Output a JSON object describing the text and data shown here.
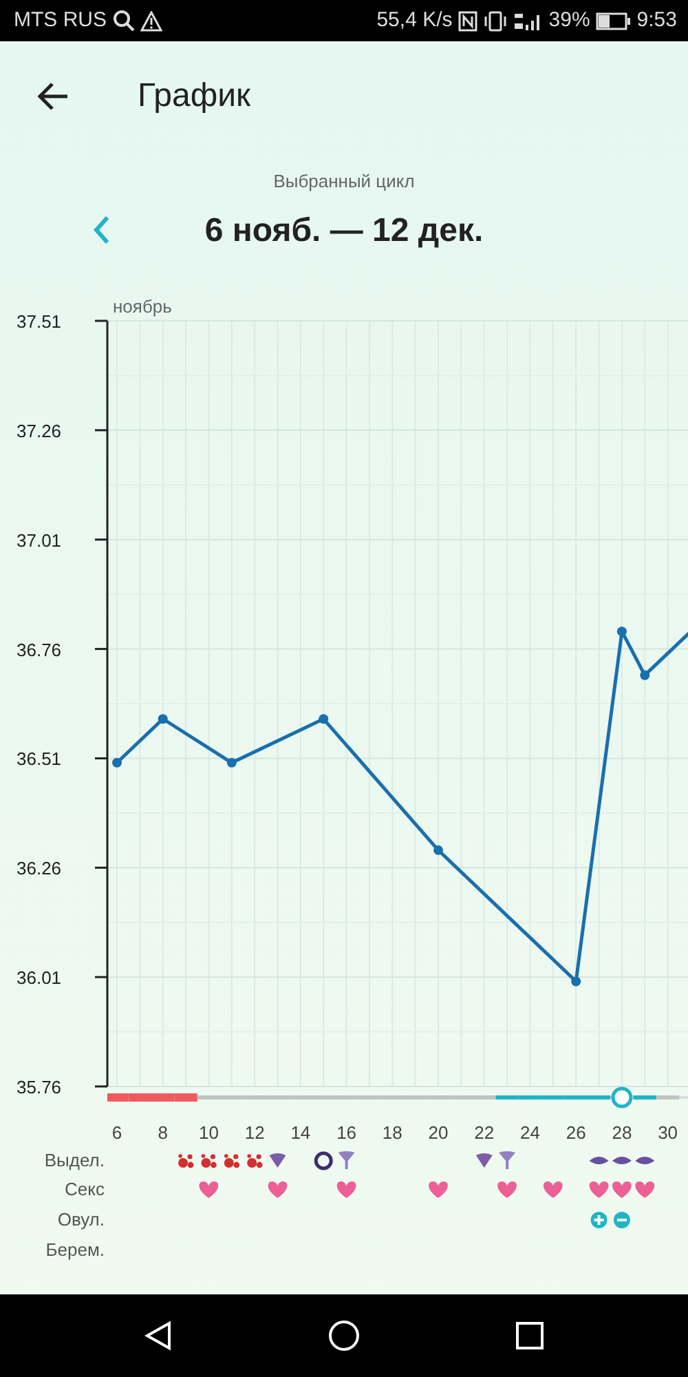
{
  "status_bar": {
    "carrier": "MTS RUS",
    "speed": "55,4 K/s",
    "battery": "39%",
    "time": "9:53"
  },
  "header": {
    "title": "График"
  },
  "cycle": {
    "caption": "Выбранный цикл",
    "range": "6 нояб. — 12 дек."
  },
  "chart": {
    "month_label": "ноябрь",
    "chart_data": {
      "type": "line",
      "x": [
        6,
        8,
        11,
        15,
        20,
        26,
        28,
        29,
        31
      ],
      "series": [
        {
          "color": "#1a6fae",
          "marker": "o",
          "values": [
            36.5,
            36.6,
            36.5,
            36.6,
            36.3,
            36.0,
            36.8,
            36.7,
            36.8
          ]
        }
      ],
      "xlim": [
        5.58,
        31
      ],
      "ylim": [
        35.76,
        37.51
      ],
      "grid": true,
      "xticks": [
        6,
        8,
        10,
        12,
        14,
        16,
        18,
        20,
        22,
        24,
        26,
        28,
        30
      ],
      "yticks": [
        35.76,
        36.01,
        36.26,
        36.51,
        36.76,
        37.01,
        37.26,
        37.51
      ]
    }
  },
  "phase_track": [
    {
      "kind": "period",
      "selected": false
    },
    {
      "kind": "period",
      "selected": false
    },
    {
      "kind": "period",
      "selected": false
    },
    {
      "kind": "period",
      "selected": false
    },
    {
      "kind": "none",
      "selected": false
    },
    {
      "kind": "none",
      "selected": false
    },
    {
      "kind": "none",
      "selected": false
    },
    {
      "kind": "none",
      "selected": false
    },
    {
      "kind": "none",
      "selected": false
    },
    {
      "kind": "none",
      "selected": false
    },
    {
      "kind": "none",
      "selected": false
    },
    {
      "kind": "none",
      "selected": false
    },
    {
      "kind": "none",
      "selected": false
    },
    {
      "kind": "none",
      "selected": false
    },
    {
      "kind": "none",
      "selected": false
    },
    {
      "kind": "none",
      "selected": false
    },
    {
      "kind": "none",
      "selected": false
    },
    {
      "kind": "fertile",
      "selected": false
    },
    {
      "kind": "fertile",
      "selected": false
    },
    {
      "kind": "fertile",
      "selected": false
    },
    {
      "kind": "fertile",
      "selected": false
    },
    {
      "kind": "fertile",
      "selected": false
    },
    {
      "kind": "fertile",
      "selected": true
    },
    {
      "kind": "fertile",
      "selected": false
    },
    {
      "kind": "none",
      "selected": false
    }
  ],
  "marker_rows": [
    {
      "label": "Выдел.",
      "cells": [
        {
          "kind": "none"
        },
        {
          "kind": "none"
        },
        {
          "kind": "none"
        },
        {
          "kind": "blood"
        },
        {
          "kind": "blood"
        },
        {
          "kind": "blood"
        },
        {
          "kind": "blood"
        },
        {
          "kind": "fan"
        },
        {
          "kind": "none"
        },
        {
          "kind": "ring"
        },
        {
          "kind": "funnel"
        },
        {
          "kind": "none"
        },
        {
          "kind": "none"
        },
        {
          "kind": "none"
        },
        {
          "kind": "none"
        },
        {
          "kind": "none"
        },
        {
          "kind": "fan"
        },
        {
          "kind": "funnel"
        },
        {
          "kind": "none"
        },
        {
          "kind": "none"
        },
        {
          "kind": "none"
        },
        {
          "kind": "lens"
        },
        {
          "kind": "lens"
        },
        {
          "kind": "lens"
        },
        {
          "kind": "none"
        }
      ]
    },
    {
      "label": "Секс",
      "cells": [
        {
          "kind": "none"
        },
        {
          "kind": "none"
        },
        {
          "kind": "none"
        },
        {
          "kind": "none"
        },
        {
          "kind": "heart"
        },
        {
          "kind": "none"
        },
        {
          "kind": "none"
        },
        {
          "kind": "heart"
        },
        {
          "kind": "none"
        },
        {
          "kind": "none"
        },
        {
          "kind": "heart"
        },
        {
          "kind": "none"
        },
        {
          "kind": "none"
        },
        {
          "kind": "none"
        },
        {
          "kind": "heart"
        },
        {
          "kind": "none"
        },
        {
          "kind": "none"
        },
        {
          "kind": "heart"
        },
        {
          "kind": "none"
        },
        {
          "kind": "heart"
        },
        {
          "kind": "none"
        },
        {
          "kind": "heart"
        },
        {
          "kind": "heart"
        },
        {
          "kind": "heart"
        },
        {
          "kind": "none"
        }
      ]
    },
    {
      "label": "Овул.",
      "cells": [
        {
          "kind": "none"
        },
        {
          "kind": "none"
        },
        {
          "kind": "none"
        },
        {
          "kind": "none"
        },
        {
          "kind": "none"
        },
        {
          "kind": "none"
        },
        {
          "kind": "none"
        },
        {
          "kind": "none"
        },
        {
          "kind": "none"
        },
        {
          "kind": "none"
        },
        {
          "kind": "none"
        },
        {
          "kind": "none"
        },
        {
          "kind": "none"
        },
        {
          "kind": "none"
        },
        {
          "kind": "none"
        },
        {
          "kind": "none"
        },
        {
          "kind": "none"
        },
        {
          "kind": "none"
        },
        {
          "kind": "none"
        },
        {
          "kind": "none"
        },
        {
          "kind": "none"
        },
        {
          "kind": "plus"
        },
        {
          "kind": "minus"
        },
        {
          "kind": "none"
        },
        {
          "kind": "none"
        }
      ]
    },
    {
      "label": "Берем."
    }
  ]
}
